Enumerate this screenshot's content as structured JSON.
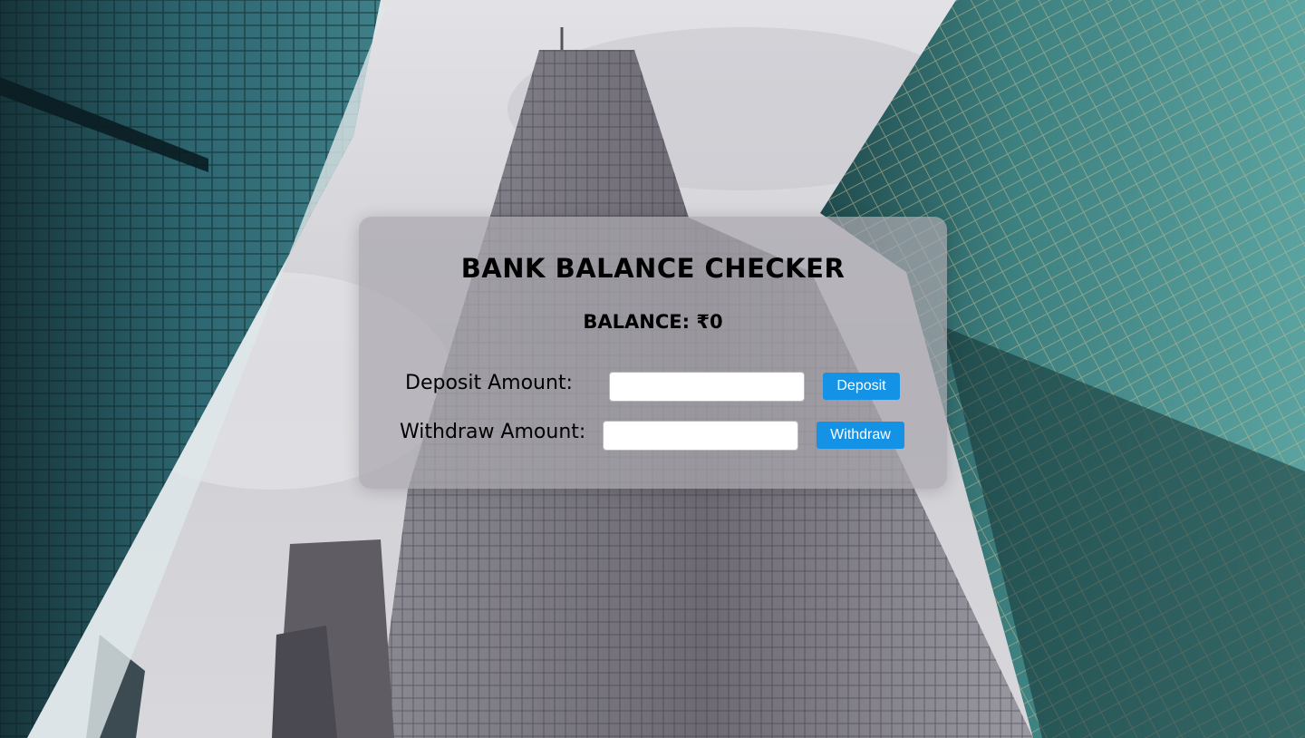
{
  "card": {
    "title": "BANK BALANCE CHECKER",
    "balance_text": "BALANCE: ₹0"
  },
  "deposit": {
    "label": "Deposit Amount:",
    "input_value": "",
    "button_label": "Deposit"
  },
  "withdraw": {
    "label": "Withdraw Amount:",
    "input_value": "",
    "button_label": "Withdraw"
  },
  "colors": {
    "button": "#1493e6",
    "button_text": "#ffffff",
    "card_bg": "rgba(170,168,175,0.72)"
  }
}
